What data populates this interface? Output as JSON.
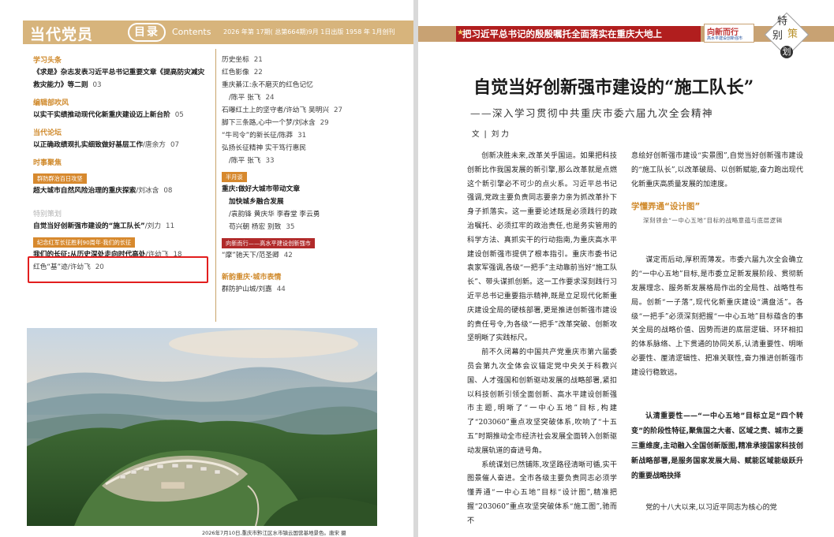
{
  "left_page": {
    "header": {
      "title": "当代党员",
      "mulu": "目录",
      "contents": "Contents",
      "issue": "2026 年第 17期( 总第664期)9月 1日出版   1958 年 1月创刊"
    },
    "left_column": [
      {
        "section": "学习头条",
        "entries": [
          {
            "title": "《求是》杂志发表习近平总书记重要文章《提高防灾减灾救灾能力》等二则",
            "page": "03"
          }
        ]
      },
      {
        "section": "编辑部吹风",
        "entries": [
          {
            "title": "以实干实绩推动现代化新重庆建设迈上新台阶",
            "page": "05"
          }
        ]
      },
      {
        "section": "当代论坛",
        "entries": [
          {
            "title": "以正确政绩观扎实细致做好基层工作",
            "author": "/唐余方",
            "page": "07"
          }
        ]
      },
      {
        "section": "时事聚焦",
        "tag": "群防群治百日攻坚",
        "entries": [
          {
            "title": "超大城市自然风险治理的重庆探索",
            "author": "/刘冰含",
            "page": "08"
          }
        ]
      },
      {
        "section": "特别策划",
        "entries": [
          {
            "title": "自觉当好创新强市建设的“施工队长”",
            "author": "/刘力",
            "page": "11"
          }
        ],
        "tag2": "纪念红军长征胜利90周年·我们的长征",
        "entries2": [
          {
            "title": "我们的长征:从历史深处走向时代高处",
            "author": "/许幼飞",
            "page": "18"
          },
          {
            "title": "红色“基”迹",
            "author": "/许幼飞",
            "page": "20",
            "light": true
          }
        ]
      }
    ],
    "right_column": {
      "lines_top": [
        {
          "text": "历史坐标",
          "page": "21"
        },
        {
          "text": "红色影像",
          "page": "22"
        },
        {
          "text": "重庆綦江:永不磨灭的红色记忆",
          "page": ""
        },
        {
          "text": "/陈平   张飞",
          "page": "24",
          "indent": true
        },
        {
          "text": "石曝红土上的坚守者/许幼飞   吴明兴",
          "page": "27"
        },
        {
          "text": "脚下三条路,心中一个梦/刘冰含",
          "page": "29"
        },
        {
          "text": "“牛司令”的新长征/陈莽",
          "page": "31"
        },
        {
          "text": "弘扬长征精神   实干笃行惠民",
          "page": ""
        },
        {
          "text": "/陈平   张飞",
          "page": "33",
          "indent": true
        }
      ],
      "tag_month": "半月谈",
      "month_title_1": "重庆:做好大城市带动文章",
      "month_title_2": "加快城乡融合发展",
      "month_authors_1": "/袁韵锋   黄庆华   李春堂   李云勇",
      "month_authors_2": "苟兴朝   杨宏   别致",
      "month_page": "35",
      "tag_new": "向新而行——高水平建设创新强市",
      "new_entry": "“摩”驰天下/范圣卿",
      "new_page": "42",
      "section_city": "新韵重庆·城市表情",
      "city_entry": "群防护山城/刘嘉",
      "city_page": "44"
    },
    "caption": "2026年7月10日,重庆市黔江区水市镇云国营基地景色。唐宋 摄"
  },
  "right_page": {
    "banner_text": "把习近平总书记的殷殷嘱托全面落实在重庆大地上",
    "banner_logo_1": "向新而行",
    "banner_logo_2": "高水平建设创新强市",
    "special": {
      "t1": "特",
      "t2": "别",
      "t3": "策",
      "t4": "划"
    },
    "headline": "自觉当好创新强市建设的“施工队长”",
    "subhead": "——深入学习贯彻中共重庆市委六届九次全会精神",
    "byline_wen": "文",
    "byline_sep": "|",
    "byline_author": "刘  力",
    "col1": [
      "创新决胜未来,改革关乎国运。如果把科技创新比作我国发展的新引擎,那么改革就是点燃这个新引擎必不可少的点火系。习近平总书记强调,党政主要负责同志要亲力亲为抓改革扑下身子抓落实。这一重要论述既是必须践行的政治嘱托、必须扛牢的政治责任,也是务实管用的科学方法、真抓实干的行动指南,为重庆高水平建设创新强市提供了根本指引。重庆市委书记袁家军强调,各级“一把手”主动靠前当好“施工队长”、带头谋抓创新。这一工作要求深刻践行习近平总书记重要指示精神,既是立足现代化新重庆建设全局的硬核部署,更是推进创新强市建设的责任号令,为各级“一把手”改革突破、创新攻坚明晰了实践标尺。",
      "前不久闭幕的中国共产党重庆市第六届委员会第九次全体会议锚定党中央关于科教兴国、人才强国和创新驱动发展的战略部署,紧扣以科技创新引领全面创新、高水平建设创新强市主题,明晰了“一中心五地”目标,构建了“203060”重点攻坚突破体系,吹响了“十五五”时期推动全市经济社会发展全面转入创新驱动发展轨道的奋进号角。",
      "系统谋划已然铺陈,攻坚路径清晰可循,实干图景催人奋进。全市各级主要负责同志必须学懂弄通“一中心五地”目标“设计图”,精准把握“203060”重点攻坚突破体系“施工图”,驰而不"
    ],
    "col2_top": "息绘好创新强市建设“实景图”,自觉当好创新强市建设的“施工队长”,以改革破局、以创新赋能,奋力跑出现代化新重庆高质量发展的加速度。",
    "sub_heading": "学懂弄通“设计图”",
    "sub_note": "深刻领会“一中心五地”目标的战略意蕴与底层逻辑",
    "col2_mid": "谋定而后动,厚积而薄发。市委六届九次全会确立的“一中心五地”目标,是市委立足新发展阶段、贯彻新发展理念、服务新发展格局作出的全局性、战略性布局。创新“一子落”,现代化新重庆建设“满盘活”。各级“一把手”必须深刻把握“一中心五地”目标蕴含的事关全局的战略价值、因势而进的底层逻辑、环环相扣的体系脉络、上下贯通的协同关系,认清重要性、明晰必要性、厘清逻辑性、把准关联性,奋力推进创新强市建设行稳致远。",
    "col2_bold": "认清重要性——“一中心五地”目标立足“四个转变”的阶段性特征,聚焦国之大者、区域之责、城市之要三重维度,主动融入全国创新版图,精准承接国家科技创新战略部署,是服务国家发展大局、赋能区域能级跃升的重要战略抉择",
    "col2_last": "党的十八大以来,以习近平同志为核心的党"
  }
}
